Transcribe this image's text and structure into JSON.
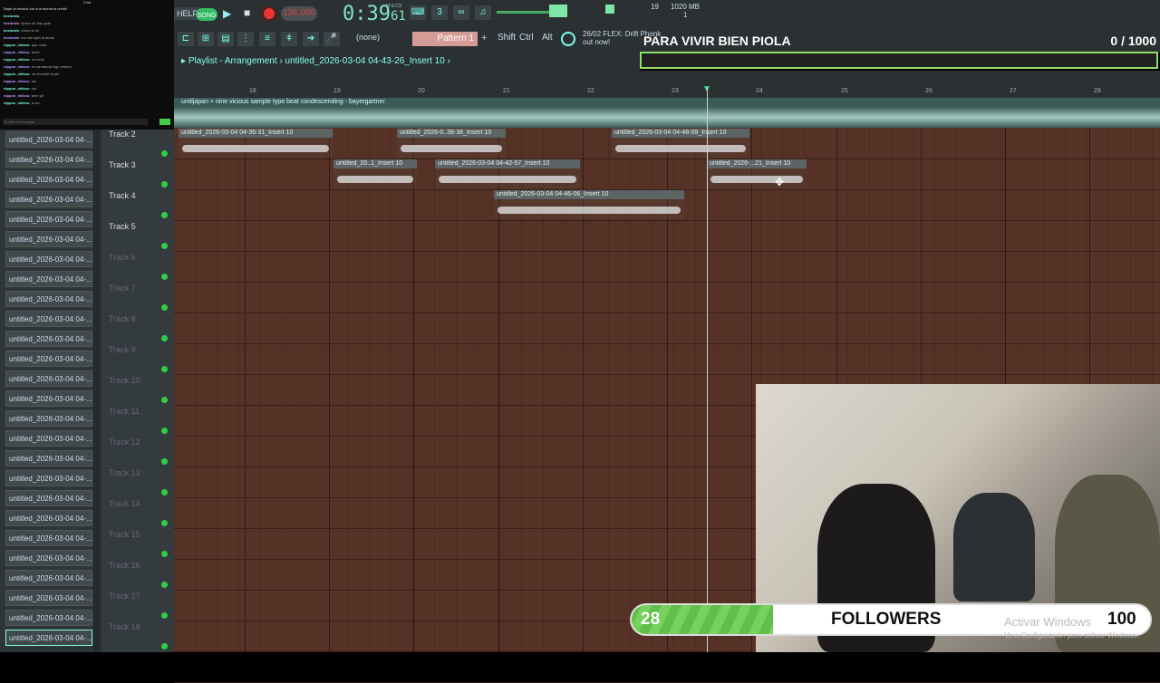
{
  "chat": {
    "header": "Chat",
    "pinned": "Bajar la música fue una buena la recibí!",
    "lines": [
      {
        "user": "lmzbeats",
        "text": "..."
      },
      {
        "user": "lmzbeats",
        "text": "tipazo de hay gote"
      },
      {
        "user": "lmzbeats",
        "text": "ahora si mi"
      },
      {
        "user": "lmzbeats",
        "text": "eso da stylo al audio"
      },
      {
        "user": "nippon_nikkou",
        "text": "que onda"
      },
      {
        "user": "nippon_nikkou",
        "text": "tenet"
      },
      {
        "user": "nippon_nikkou",
        "text": "un bcho"
      },
      {
        "user": "nippon_nikkou",
        "text": "en lambarda logo mulero"
      },
      {
        "user": "nippon_nikkou",
        "text": "no chuchel mudo"
      },
      {
        "user": "nippon_nikkou",
        "text": "wa"
      },
      {
        "user": "nippon_nikkou",
        "text": "wa"
      },
      {
        "user": "nippon_nikkou",
        "text": "ame gil"
      },
      {
        "user": "nippon_nikkou",
        "text": "a cro"
      }
    ],
    "input_placeholder": "Enviar un mensaje"
  },
  "toolbar": {
    "help": "HELP",
    "song": "SONG",
    "tempo": "136.000",
    "time": "0:39",
    "time_sub": "61",
    "time_label": "M:S:CS",
    "cpu": "19",
    "memory": "1020 MB",
    "memory_sub": "1",
    "pattern_none": "(none)",
    "pattern": "Pattern 1",
    "keys": [
      "Shift",
      "Ctrl",
      "Alt"
    ],
    "news_line1": "26/02  FLEX: Drift Phonk",
    "news_line2": "out now!"
  },
  "goal": {
    "title": "PARA VIVIR BIEN PIOLA",
    "count": "0  / 1000"
  },
  "playlist": {
    "title": "Playlist - Arrangement",
    "breadcrumb": "untitled_2026-03-04 04-43-26_Insert 10",
    "bars": [
      "18",
      "19",
      "20",
      "21",
      "22",
      "23",
      "24",
      "25",
      "26",
      "27",
      "28"
    ],
    "track1_title": "untiljapan + nine vicious sample type beat condescending - bayergartner",
    "tracks": [
      "Track 2",
      "Track 3",
      "Track 4",
      "Track 5",
      "Track 6",
      "Track 7",
      "Track 8",
      "Track 9",
      "Track 10",
      "Track 11",
      "Track 12",
      "Track 13",
      "Track 14",
      "Track 15",
      "Track 16",
      "Track 17",
      "Track 18"
    ],
    "clips": [
      {
        "label": "untitled_2026-03-04 04-36-31_Insert 10"
      },
      {
        "label": "untitled_2026-0..38-38_Insert 10"
      },
      {
        "label": "untitled_2026-03-04 04-48-09_Insert 10"
      },
      {
        "label": "untitled_20..1_Insert 10"
      },
      {
        "label": "untitled_2026-03-04 04-42-57_Insert 10"
      },
      {
        "label": "untitled_2026-...21_Insert 10"
      },
      {
        "label": "untitled_2026-03-04 04-46-06_Insert 10"
      }
    ],
    "slot_label": "untitled_2026-03-04 04-..."
  },
  "followers": {
    "current": "28",
    "label": "FOLLOWERS",
    "goal": "100",
    "progress": 0.28
  },
  "windows": {
    "activate": "Activar Windows",
    "sub": "Ve a Configuración para activar Windows."
  }
}
